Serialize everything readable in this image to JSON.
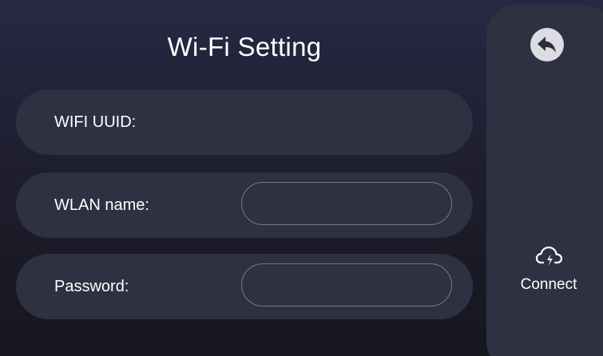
{
  "header": {
    "title": "Wi-Fi Setting"
  },
  "form": {
    "wifi_uuid_label": "WIFI UUID:",
    "wlan_name_label": "WLAN name:",
    "wlan_name_value": "",
    "password_label": "Password:",
    "password_value": ""
  },
  "side_panel": {
    "back_icon": "back-arrow-icon",
    "connect_icon": "cloud-connect-icon",
    "connect_label": "Connect"
  },
  "colors": {
    "background_top": "#272843",
    "background_bottom": "#16161f",
    "row_fill": "#2f3041",
    "field_border": "#77788c",
    "text": "#ffffff"
  }
}
